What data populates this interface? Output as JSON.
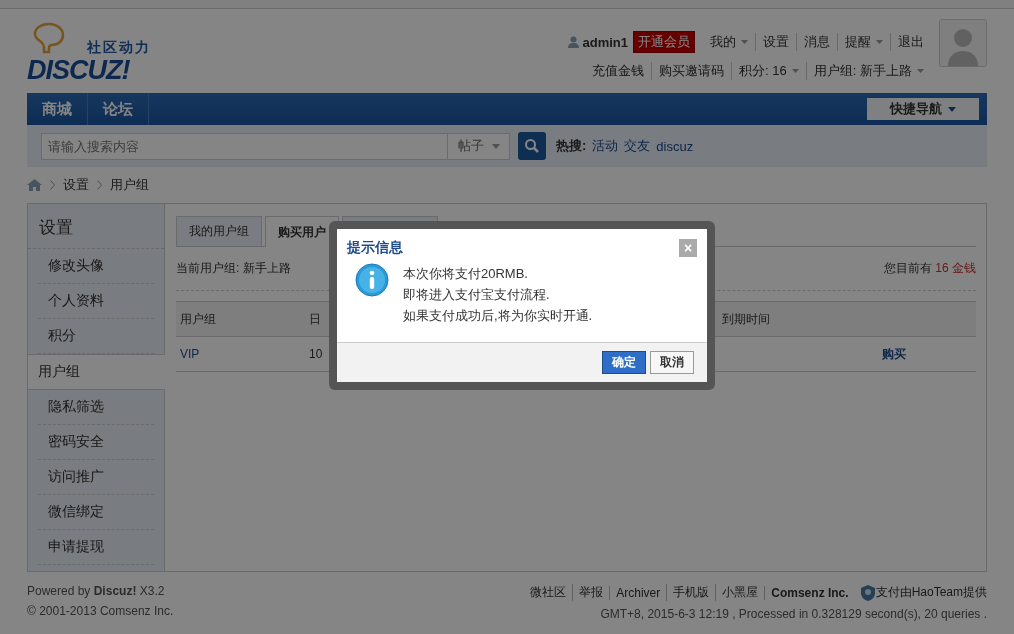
{
  "header": {
    "logo_tagline": "社区动力",
    "logo_text": "DISCUZ!",
    "username": "admin1",
    "vip_button": "开通会员",
    "top_links": [
      {
        "label": "我的",
        "dropdown": true
      },
      {
        "label": "设置",
        "dropdown": false
      },
      {
        "label": "消息",
        "dropdown": false
      },
      {
        "label": "提醒",
        "dropdown": true
      },
      {
        "label": "退出",
        "dropdown": false
      }
    ],
    "sub_links": [
      {
        "label": "充值金钱",
        "dropdown": false
      },
      {
        "label": "购买邀请码",
        "dropdown": false
      },
      {
        "label": "积分: 16",
        "dropdown": true
      },
      {
        "label": "用户组: 新手上路",
        "dropdown": true
      }
    ]
  },
  "nav": {
    "items": [
      "商城",
      "论坛"
    ],
    "quick_nav": "快捷导航"
  },
  "search": {
    "placeholder": "请输入搜索内容",
    "type": "帖子",
    "hot_label": "热搜:",
    "hot": [
      "活动",
      "交友",
      "discuz"
    ]
  },
  "breadcrumb": [
    "设置",
    "用户组"
  ],
  "sidebar": {
    "title": "设置",
    "items": [
      {
        "label": "修改头像",
        "selected": false
      },
      {
        "label": "个人资料",
        "selected": false
      },
      {
        "label": "积分",
        "selected": false
      },
      {
        "label": "用户组",
        "selected": true
      },
      {
        "label": "隐私筛选",
        "selected": false
      },
      {
        "label": "密码安全",
        "selected": false
      },
      {
        "label": "访问推广",
        "selected": false
      },
      {
        "label": "微信绑定",
        "selected": false
      },
      {
        "label": "申请提现",
        "selected": false
      }
    ]
  },
  "content": {
    "tabs": [
      {
        "label": "我的用户组",
        "selected": false
      },
      {
        "label": "购买用户",
        "selected": true
      }
    ],
    "current_group": "当前用户组: 新手上路",
    "balance_label": "您目前有",
    "balance": "16 金钱",
    "table": {
      "columns": [
        "用户组",
        "日",
        "到期时间"
      ],
      "rows": [
        {
          "cells": [
            "VIP",
            "10"
          ],
          "action": "购买"
        }
      ]
    }
  },
  "dialog": {
    "title": "提示信息",
    "close": "×",
    "lines": [
      "本次你将支付20RMB.",
      "即将进入支付宝支付流程.",
      "如果支付成功后,将为你实时开通."
    ],
    "buttons": [
      {
        "label": "确定",
        "primary": true
      },
      {
        "label": "取消",
        "primary": false
      }
    ]
  },
  "footer": {
    "powered": "Powered by **Discuz!** X3.2",
    "copyright": "© 2001-2013 Comsenz Inc.",
    "links": [
      {
        "label": "微社区",
        "bold": false
      },
      {
        "label": "举报",
        "bold": false
      },
      {
        "label": "Archiver",
        "bold": false
      },
      {
        "label": "手机版",
        "bold": false
      },
      {
        "label": "小黑屋",
        "bold": false
      },
      {
        "label": "Comsenz Inc.",
        "bold": true
      }
    ],
    "pay_note": "支付由HaoTeam提供",
    "stats": "GMT+8, 2015-6-3 12:19 , Processed in 0.328129 second(s), 20 queries ."
  }
}
